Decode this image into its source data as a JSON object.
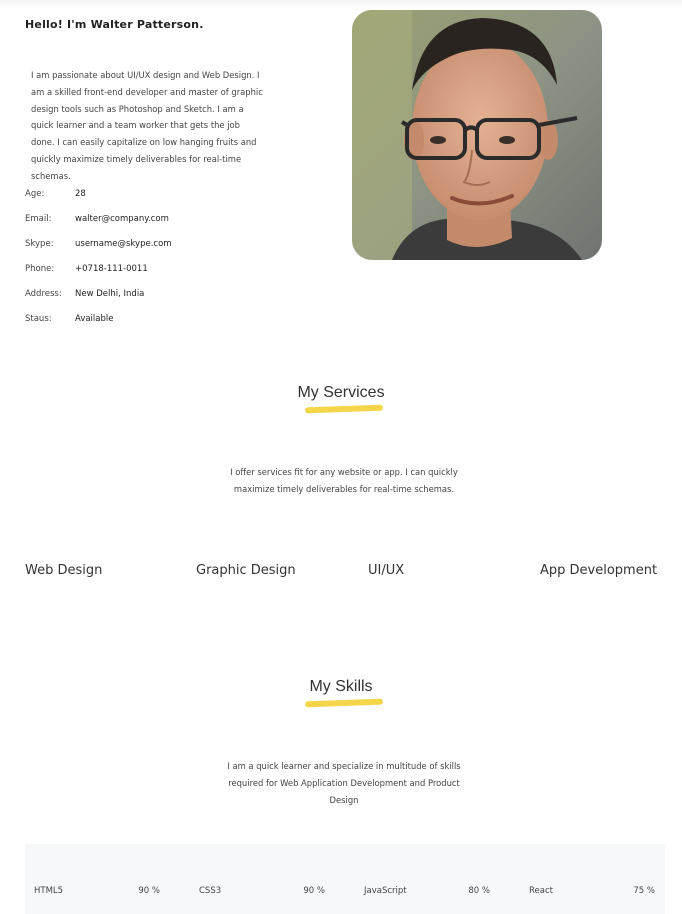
{
  "header": {
    "greeting": "Hello! I'm Walter Patterson."
  },
  "about": {
    "text": "I am passionate about UI/UX design and Web Design. I am a skilled front-end developer and master of graphic design tools such as Photoshop and Sketch. I am a quick learner and a team worker that gets the job done. I can easily capitalize on low hanging fruits and quickly maximize timely deliverables for real-time schemas."
  },
  "info": [
    {
      "label": "Age:",
      "value": "28"
    },
    {
      "label": "Email:",
      "value": "walter@company.com"
    },
    {
      "label": "Skype:",
      "value": "username@skype.com"
    },
    {
      "label": "Phone:",
      "value": "+0718-111-0011"
    },
    {
      "label": "Address:",
      "value": "New Delhi, India"
    },
    {
      "label": "Staus:",
      "value": "Available"
    }
  ],
  "services": {
    "title": "My Services",
    "description": "I offer services fit for any website or app. I can quickly maximize timely deliverables for real-time schemas.",
    "items": [
      "Web Design",
      "Graphic Design",
      "UI/UX",
      "App Development"
    ]
  },
  "skills": {
    "title": "My Skills",
    "description": "I am a quick learner and specialize in multitude of skills required for Web Application Development and Product Design",
    "items": [
      {
        "name": "HTML5",
        "percent": "90 %"
      },
      {
        "name": "CSS3",
        "percent": "90 %"
      },
      {
        "name": "JavaScript",
        "percent": "80 %"
      },
      {
        "name": "React",
        "percent": "75 %"
      }
    ]
  },
  "colors": {
    "accent_underline": "#f5d64a",
    "skills_bg": "#f7f8f9"
  }
}
